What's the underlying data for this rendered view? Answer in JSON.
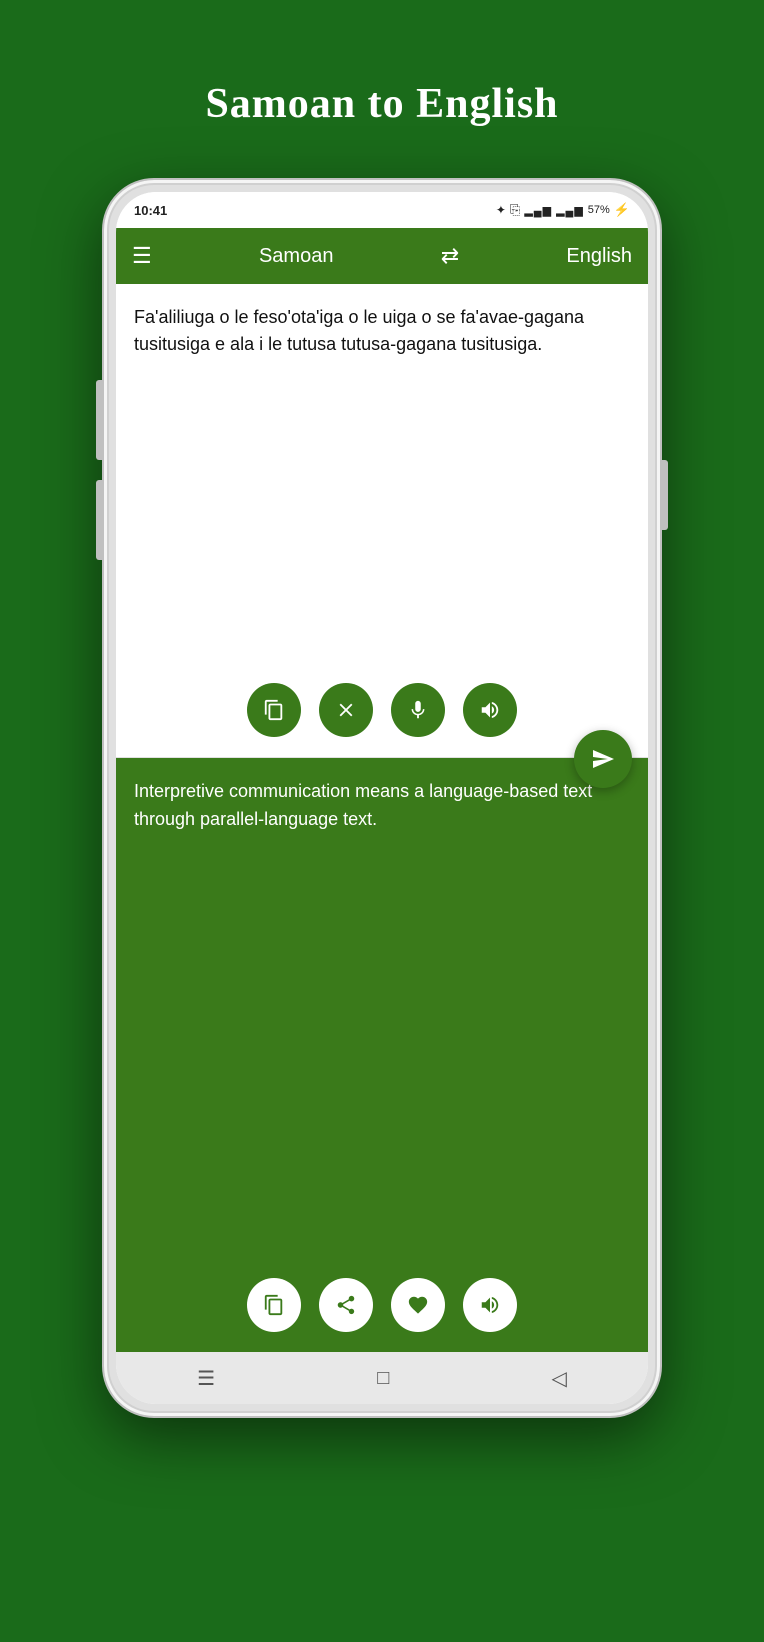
{
  "page": {
    "title": "Samoan to English",
    "background_color": "#1a6b1a"
  },
  "status_bar": {
    "time": "10:41",
    "battery": "57%",
    "signal_icons": "● ▲ ▲"
  },
  "header": {
    "menu_icon": "☰",
    "lang_from": "Samoan",
    "swap_icon": "⇄",
    "lang_to": "English"
  },
  "input": {
    "text": "Fa'aliliuga o le feso'ota'iga o le uiga o se fa'avae-gagana tusitusiga e ala i le tutusa tutusa-gagana tusitusiga.",
    "clipboard_btn": "clipboard",
    "clear_btn": "×",
    "mic_btn": "mic",
    "speaker_btn": "speaker",
    "send_btn": "▶"
  },
  "output": {
    "text": "Interpretive communication means a language-based text through parallel-language text.",
    "copy_btn": "copy",
    "share_btn": "share",
    "favorite_btn": "heart",
    "speaker_btn": "speaker"
  },
  "nav_bar": {
    "menu_icon": "☰",
    "home_icon": "□",
    "back_icon": "◁"
  }
}
